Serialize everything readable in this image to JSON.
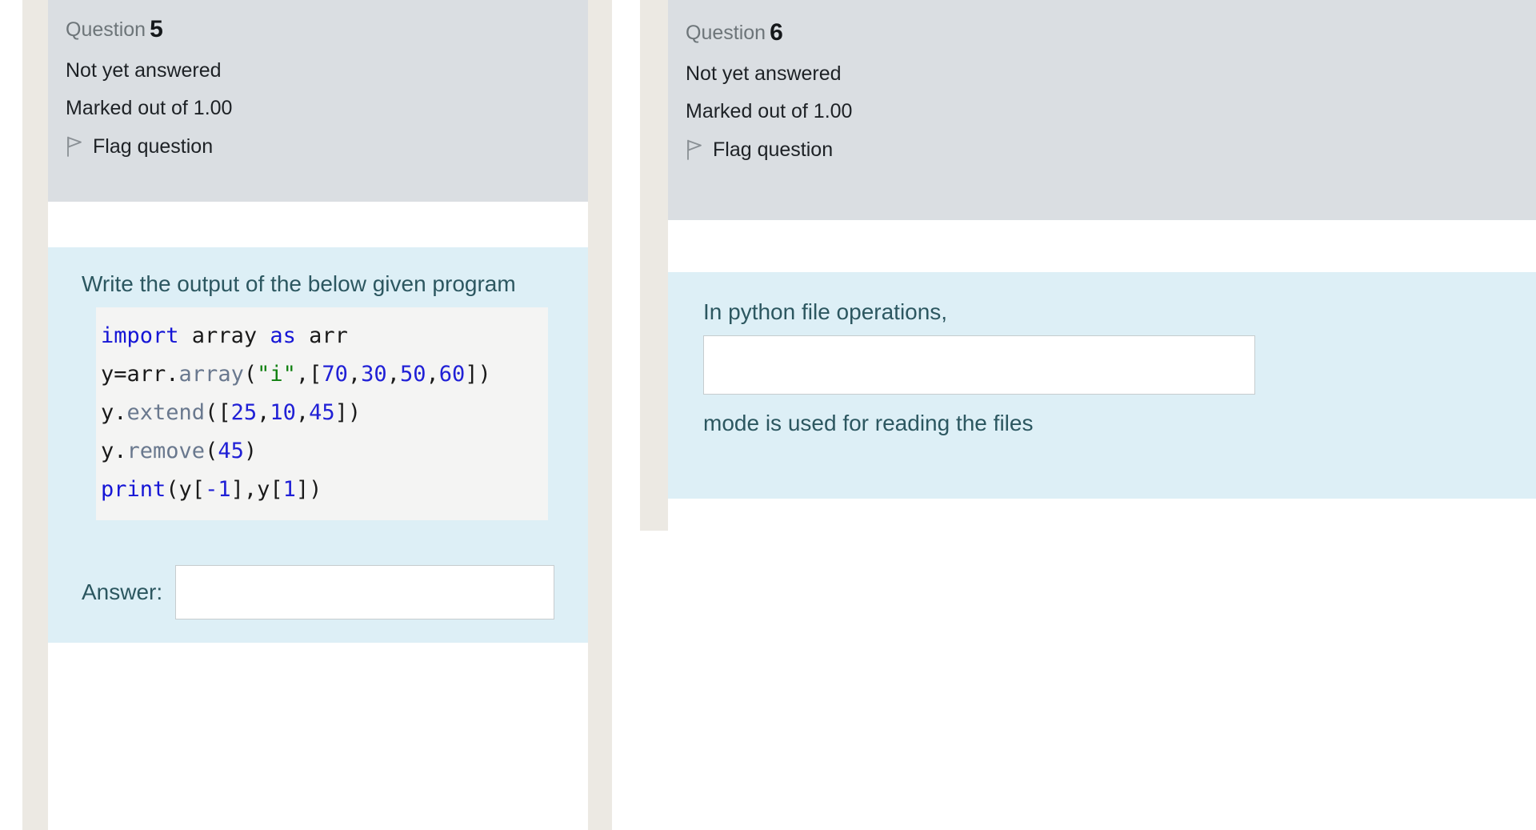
{
  "page": {
    "background": "#ffffff",
    "header_bg": "#dadee2",
    "content_bg": "#ddeff6",
    "strip_bg": "#ece9e3",
    "code_bg": "#f4f4f3",
    "text_accent": "#2c5760"
  },
  "questions": [
    {
      "number_label": "Question",
      "number": "5",
      "status": "Not yet answered",
      "marks": "Marked out of 1.00",
      "flag_label": "Flag question",
      "flag_icon": "flag-outline-icon",
      "prompt": "Write the output of the below given program",
      "code_lines": [
        [
          {
            "t": "import",
            "c": "kw"
          },
          {
            "t": " array ",
            "c": "pl"
          },
          {
            "t": "as",
            "c": "kw"
          },
          {
            "t": " arr",
            "c": "pl"
          }
        ],
        [
          {
            "t": "y=arr.",
            "c": "pl"
          },
          {
            "t": "array",
            "c": "fn"
          },
          {
            "t": "(",
            "c": "pl"
          },
          {
            "t": "\"i\"",
            "c": "str"
          },
          {
            "t": ",[",
            "c": "pl"
          },
          {
            "t": "70",
            "c": "num"
          },
          {
            "t": ",",
            "c": "pl"
          },
          {
            "t": "30",
            "c": "num"
          },
          {
            "t": ",",
            "c": "pl"
          },
          {
            "t": "50",
            "c": "num"
          },
          {
            "t": ",",
            "c": "pl"
          },
          {
            "t": "60",
            "c": "num"
          },
          {
            "t": "])",
            "c": "pl"
          }
        ],
        [
          {
            "t": "y.",
            "c": "pl"
          },
          {
            "t": "extend",
            "c": "fn"
          },
          {
            "t": "([",
            "c": "pl"
          },
          {
            "t": "25",
            "c": "num"
          },
          {
            "t": ",",
            "c": "pl"
          },
          {
            "t": "10",
            "c": "num"
          },
          {
            "t": ",",
            "c": "pl"
          },
          {
            "t": "45",
            "c": "num"
          },
          {
            "t": "])",
            "c": "pl"
          }
        ],
        [
          {
            "t": "y.",
            "c": "pl"
          },
          {
            "t": "remove",
            "c": "fn"
          },
          {
            "t": "(",
            "c": "pl"
          },
          {
            "t": "45",
            "c": "num"
          },
          {
            "t": ")",
            "c": "pl"
          }
        ],
        [
          {
            "t": "print",
            "c": "kw"
          },
          {
            "t": "(y[",
            "c": "pl"
          },
          {
            "t": "-1",
            "c": "num"
          },
          {
            "t": "],y[",
            "c": "pl"
          },
          {
            "t": "1",
            "c": "num"
          },
          {
            "t": "])",
            "c": "pl"
          }
        ]
      ],
      "answer_label": "Answer:",
      "answer_value": "",
      "answer_placeholder": ""
    },
    {
      "number_label": "Question",
      "number": "6",
      "status": "Not yet answered",
      "marks": "Marked out of 1.00",
      "flag_label": "Flag question",
      "flag_icon": "flag-outline-icon",
      "prompt_before": "In python file operations,",
      "prompt_after": "mode is used for reading the files",
      "answer_value": "",
      "answer_placeholder": ""
    }
  ]
}
